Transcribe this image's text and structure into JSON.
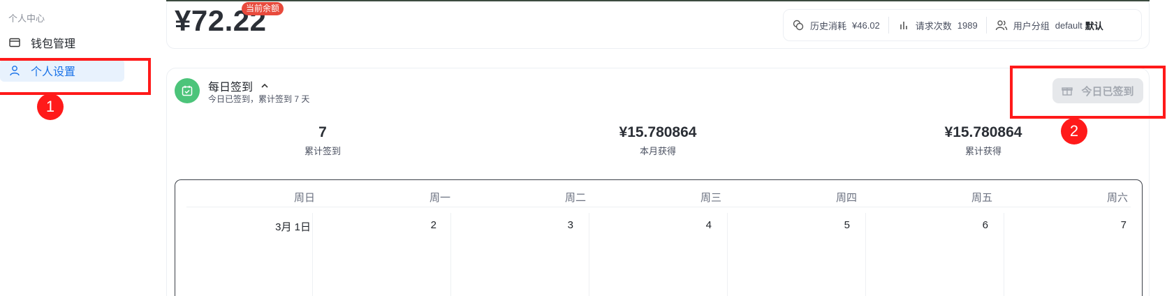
{
  "sidebar": {
    "section_title": "个人中心",
    "items": [
      {
        "label": "钱包管理",
        "icon": "wallet-icon",
        "active": false
      },
      {
        "label": "个人设置",
        "icon": "user-icon",
        "active": true
      }
    ]
  },
  "balance": {
    "amount": "¥72.22",
    "badge": "当前余额",
    "stats": [
      {
        "icon": "coins-icon",
        "label": "历史消耗",
        "value": "¥46.02"
      },
      {
        "icon": "bar-chart-icon",
        "label": "请求次数",
        "value": "1989"
      },
      {
        "icon": "users-icon",
        "label": "用户分组",
        "value": "default",
        "value2": "默认"
      }
    ]
  },
  "checkin": {
    "title": "每日签到",
    "subtitle": "今日已签到，累计签到 7 天",
    "button_label": "今日已签到",
    "metrics": [
      {
        "value": "7",
        "caption": "累计签到"
      },
      {
        "value": "¥15.780864",
        "caption": "本月获得"
      },
      {
        "value": "¥15.780864",
        "caption": "累计获得"
      }
    ]
  },
  "calendar": {
    "weekdays": [
      "周日",
      "周一",
      "周二",
      "周三",
      "周四",
      "周五",
      "周六"
    ],
    "days": [
      "3月 1日",
      "2",
      "3",
      "4",
      "5",
      "6",
      "7"
    ]
  },
  "annotations": [
    "1",
    "2"
  ],
  "colors": {
    "accent": "#1a73e8",
    "annotation": "#ff1a1a",
    "checkin_green": "#4cc47a",
    "badge_red": "#e84a3c"
  }
}
